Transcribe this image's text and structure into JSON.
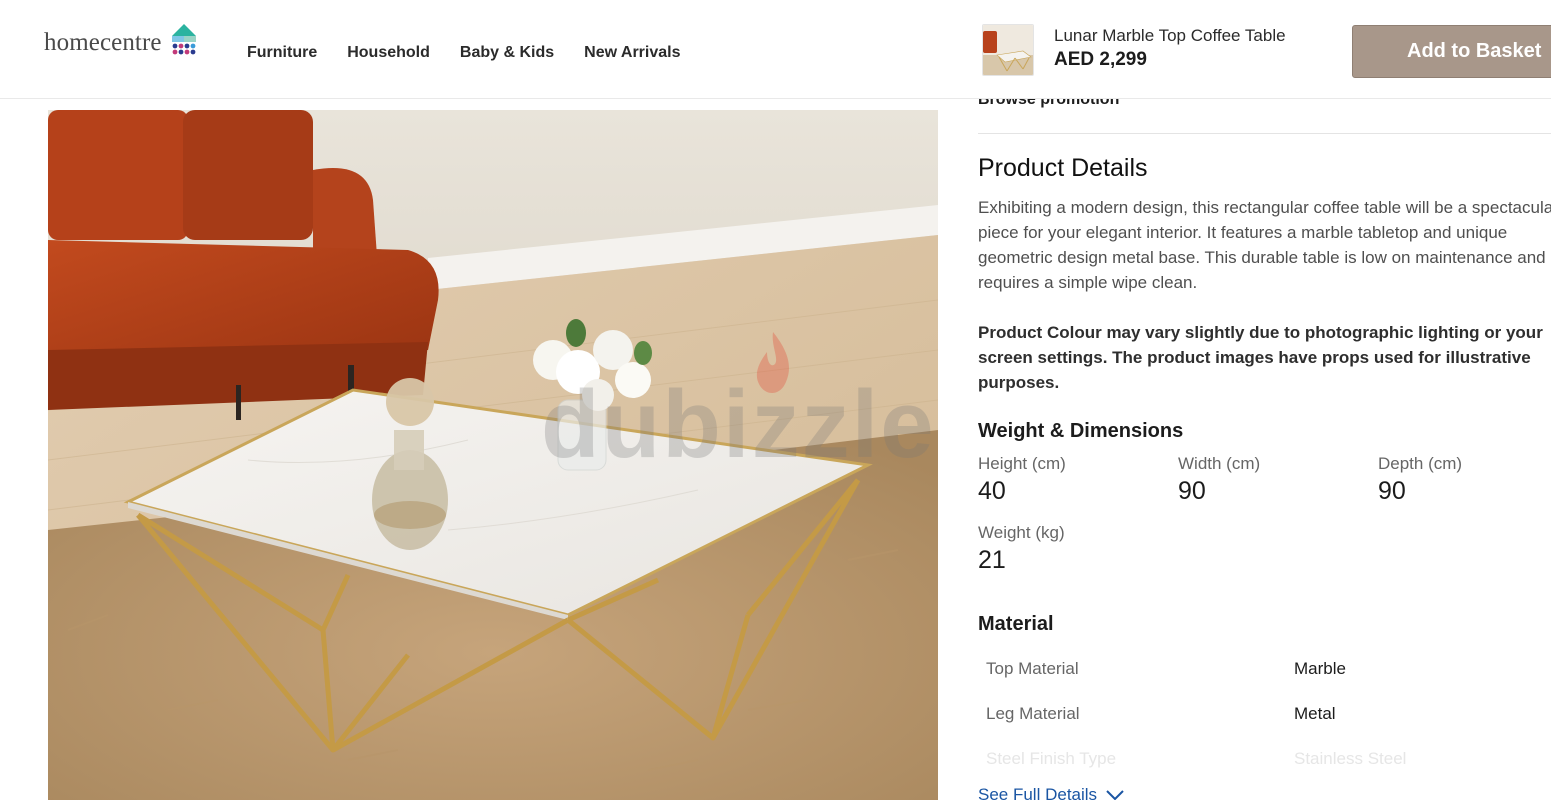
{
  "header": {
    "logo_text": "homecentre",
    "nav": [
      "Furniture",
      "Household",
      "Baby & Kids",
      "New Arrivals"
    ],
    "sticky_product": {
      "name": "Lunar Marble Top Coffee Table",
      "price": "AED 2,299",
      "add_to_basket": "Add to Basket"
    }
  },
  "image": {
    "watermark": "dubizzle"
  },
  "details": {
    "browse_promotion": "Browse promotion",
    "title": "Product Details",
    "description": "Exhibiting a modern design, this rectangular coffee table will be a spectacular piece for your elegant interior. It features a marble tabletop and unique geometric design metal base. This durable table is low on maintenance and requires a simple wipe clean.",
    "note": "Product Colour may vary slightly due to photographic lighting or your screen settings. The product images have props used for illustrative purposes.",
    "dimensions_title": "Weight & Dimensions",
    "dimensions": [
      {
        "label": "Height (cm)",
        "value": "40"
      },
      {
        "label": "Width (cm)",
        "value": "90"
      },
      {
        "label": "Depth (cm)",
        "value": "90"
      },
      {
        "label": "Weight (kg)",
        "value": "21"
      }
    ],
    "material_title": "Material",
    "materials": [
      {
        "label": "Top Material",
        "value": "Marble"
      },
      {
        "label": "Leg Material",
        "value": "Metal"
      },
      {
        "label": "Steel Finish Type",
        "value": "Stainless Steel"
      }
    ],
    "see_full_details": "See Full Details"
  },
  "colors": {
    "basket_button": "#a8978a",
    "link": "#1a55a3"
  }
}
